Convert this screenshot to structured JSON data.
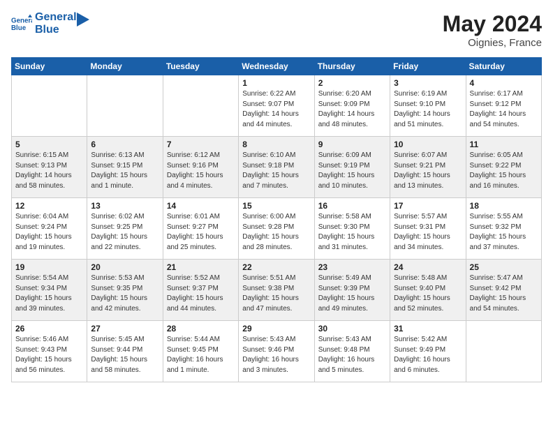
{
  "header": {
    "logo_line1": "General",
    "logo_line2": "Blue",
    "month_year": "May 2024",
    "location": "Oignies, France"
  },
  "days_of_week": [
    "Sunday",
    "Monday",
    "Tuesday",
    "Wednesday",
    "Thursday",
    "Friday",
    "Saturday"
  ],
  "weeks": [
    [
      {
        "day": "",
        "info": ""
      },
      {
        "day": "",
        "info": ""
      },
      {
        "day": "",
        "info": ""
      },
      {
        "day": "1",
        "info": "Sunrise: 6:22 AM\nSunset: 9:07 PM\nDaylight: 14 hours\nand 44 minutes."
      },
      {
        "day": "2",
        "info": "Sunrise: 6:20 AM\nSunset: 9:09 PM\nDaylight: 14 hours\nand 48 minutes."
      },
      {
        "day": "3",
        "info": "Sunrise: 6:19 AM\nSunset: 9:10 PM\nDaylight: 14 hours\nand 51 minutes."
      },
      {
        "day": "4",
        "info": "Sunrise: 6:17 AM\nSunset: 9:12 PM\nDaylight: 14 hours\nand 54 minutes."
      }
    ],
    [
      {
        "day": "5",
        "info": "Sunrise: 6:15 AM\nSunset: 9:13 PM\nDaylight: 14 hours\nand 58 minutes."
      },
      {
        "day": "6",
        "info": "Sunrise: 6:13 AM\nSunset: 9:15 PM\nDaylight: 15 hours\nand 1 minute."
      },
      {
        "day": "7",
        "info": "Sunrise: 6:12 AM\nSunset: 9:16 PM\nDaylight: 15 hours\nand 4 minutes."
      },
      {
        "day": "8",
        "info": "Sunrise: 6:10 AM\nSunset: 9:18 PM\nDaylight: 15 hours\nand 7 minutes."
      },
      {
        "day": "9",
        "info": "Sunrise: 6:09 AM\nSunset: 9:19 PM\nDaylight: 15 hours\nand 10 minutes."
      },
      {
        "day": "10",
        "info": "Sunrise: 6:07 AM\nSunset: 9:21 PM\nDaylight: 15 hours\nand 13 minutes."
      },
      {
        "day": "11",
        "info": "Sunrise: 6:05 AM\nSunset: 9:22 PM\nDaylight: 15 hours\nand 16 minutes."
      }
    ],
    [
      {
        "day": "12",
        "info": "Sunrise: 6:04 AM\nSunset: 9:24 PM\nDaylight: 15 hours\nand 19 minutes."
      },
      {
        "day": "13",
        "info": "Sunrise: 6:02 AM\nSunset: 9:25 PM\nDaylight: 15 hours\nand 22 minutes."
      },
      {
        "day": "14",
        "info": "Sunrise: 6:01 AM\nSunset: 9:27 PM\nDaylight: 15 hours\nand 25 minutes."
      },
      {
        "day": "15",
        "info": "Sunrise: 6:00 AM\nSunset: 9:28 PM\nDaylight: 15 hours\nand 28 minutes."
      },
      {
        "day": "16",
        "info": "Sunrise: 5:58 AM\nSunset: 9:30 PM\nDaylight: 15 hours\nand 31 minutes."
      },
      {
        "day": "17",
        "info": "Sunrise: 5:57 AM\nSunset: 9:31 PM\nDaylight: 15 hours\nand 34 minutes."
      },
      {
        "day": "18",
        "info": "Sunrise: 5:55 AM\nSunset: 9:32 PM\nDaylight: 15 hours\nand 37 minutes."
      }
    ],
    [
      {
        "day": "19",
        "info": "Sunrise: 5:54 AM\nSunset: 9:34 PM\nDaylight: 15 hours\nand 39 minutes."
      },
      {
        "day": "20",
        "info": "Sunrise: 5:53 AM\nSunset: 9:35 PM\nDaylight: 15 hours\nand 42 minutes."
      },
      {
        "day": "21",
        "info": "Sunrise: 5:52 AM\nSunset: 9:37 PM\nDaylight: 15 hours\nand 44 minutes."
      },
      {
        "day": "22",
        "info": "Sunrise: 5:51 AM\nSunset: 9:38 PM\nDaylight: 15 hours\nand 47 minutes."
      },
      {
        "day": "23",
        "info": "Sunrise: 5:49 AM\nSunset: 9:39 PM\nDaylight: 15 hours\nand 49 minutes."
      },
      {
        "day": "24",
        "info": "Sunrise: 5:48 AM\nSunset: 9:40 PM\nDaylight: 15 hours\nand 52 minutes."
      },
      {
        "day": "25",
        "info": "Sunrise: 5:47 AM\nSunset: 9:42 PM\nDaylight: 15 hours\nand 54 minutes."
      }
    ],
    [
      {
        "day": "26",
        "info": "Sunrise: 5:46 AM\nSunset: 9:43 PM\nDaylight: 15 hours\nand 56 minutes."
      },
      {
        "day": "27",
        "info": "Sunrise: 5:45 AM\nSunset: 9:44 PM\nDaylight: 15 hours\nand 58 minutes."
      },
      {
        "day": "28",
        "info": "Sunrise: 5:44 AM\nSunset: 9:45 PM\nDaylight: 16 hours\nand 1 minute."
      },
      {
        "day": "29",
        "info": "Sunrise: 5:43 AM\nSunset: 9:46 PM\nDaylight: 16 hours\nand 3 minutes."
      },
      {
        "day": "30",
        "info": "Sunrise: 5:43 AM\nSunset: 9:48 PM\nDaylight: 16 hours\nand 5 minutes."
      },
      {
        "day": "31",
        "info": "Sunrise: 5:42 AM\nSunset: 9:49 PM\nDaylight: 16 hours\nand 6 minutes."
      },
      {
        "day": "",
        "info": ""
      }
    ]
  ]
}
